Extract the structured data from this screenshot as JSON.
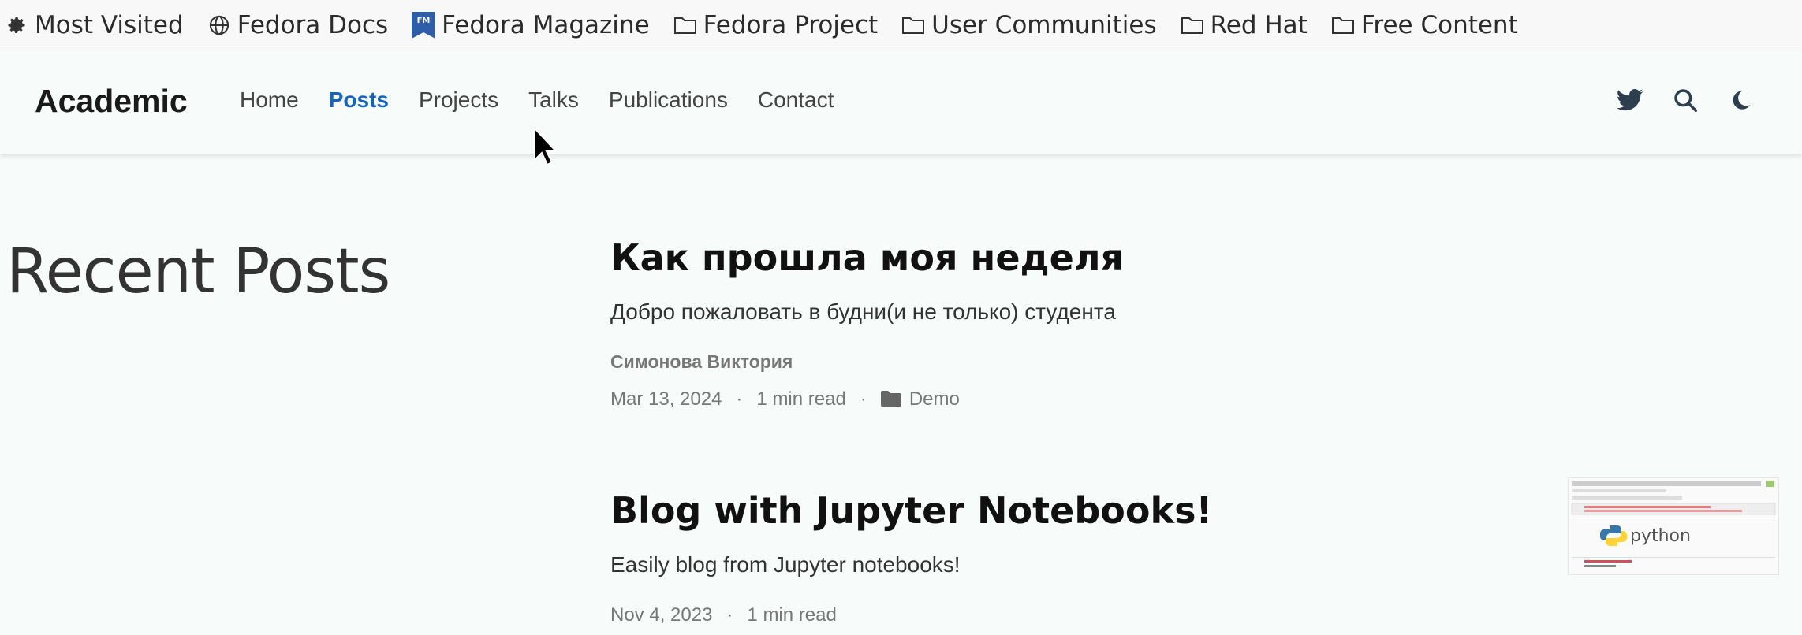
{
  "bookmarks": [
    {
      "label": "Most Visited",
      "icon": "gear-icon"
    },
    {
      "label": "Fedora Docs",
      "icon": "globe-icon"
    },
    {
      "label": "Fedora Magazine",
      "icon": "fedora-magazine-icon"
    },
    {
      "label": "Fedora Project",
      "icon": "folder-icon"
    },
    {
      "label": "User Communities",
      "icon": "folder-icon"
    },
    {
      "label": "Red Hat",
      "icon": "folder-icon"
    },
    {
      "label": "Free Content",
      "icon": "folder-icon"
    }
  ],
  "navbar": {
    "brand": "Academic",
    "links": [
      "Home",
      "Posts",
      "Projects",
      "Talks",
      "Publications",
      "Contact"
    ],
    "active": "Posts",
    "tools": [
      "twitter-icon",
      "search-icon",
      "moon-icon"
    ]
  },
  "page": {
    "title": "Recent Posts"
  },
  "posts": [
    {
      "title": "Как прошла моя неделя",
      "summary": "Добро пожаловать в будни(и не только) студента",
      "author": "Симонова Виктория",
      "date": "Mar 13, 2024",
      "read_time": "1 min read",
      "category": "Demo"
    },
    {
      "title": "Blog with Jupyter Notebooks!",
      "summary": "Easily blog from Jupyter notebooks!",
      "date": "Nov 4, 2023",
      "read_time": "1 min read",
      "thumbnail_text": "python"
    }
  ],
  "colors": {
    "active_link": "#1565c0",
    "background": "#f7fbfa"
  }
}
